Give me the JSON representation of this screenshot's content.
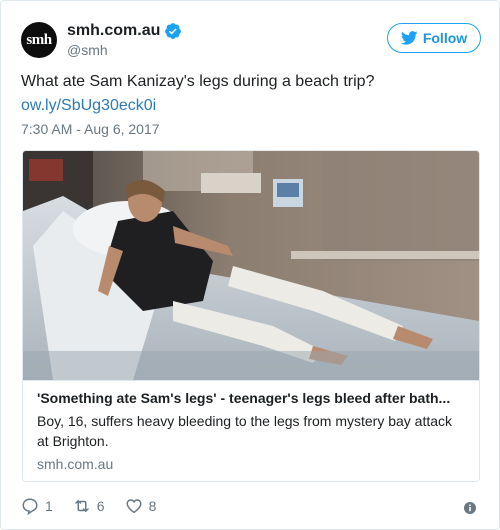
{
  "author": {
    "avatar_text": "smh",
    "display_name": "smh.com.au",
    "handle": "@smh"
  },
  "follow_label": "Follow",
  "tweet": {
    "text": "What ate Sam Kanizay's legs during a beach trip?",
    "link_text": "ow.ly/SbUg30eck0i",
    "timestamp": "7:30 AM - Aug 6, 2017"
  },
  "card": {
    "title": "'Something ate Sam's legs' - teenager's legs bleed after bath...",
    "description": "Boy, 16, suffers heavy bleeding to the legs from mystery bay attack at Brighton.",
    "domain": "smh.com.au"
  },
  "actions": {
    "replies": "1",
    "retweets": "6",
    "likes": "8"
  },
  "colors": {
    "brand_blue": "#1da1f2",
    "link_blue": "#2b7bb9",
    "muted_gray": "#697882",
    "border": "#e1e8ed"
  }
}
